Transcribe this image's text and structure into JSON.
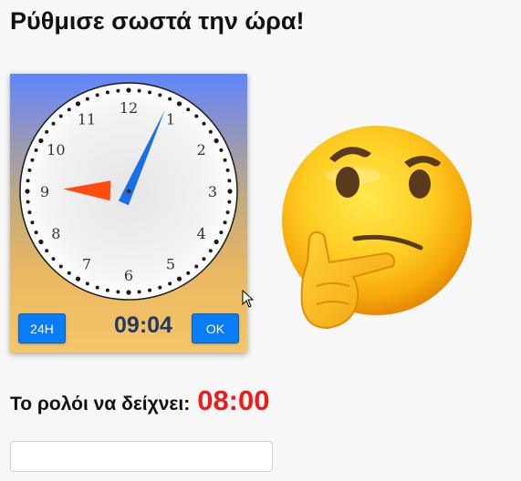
{
  "page": {
    "title": "Ρύθμισε σωστά την ώρα!"
  },
  "clock": {
    "numerals": [
      "12",
      "1",
      "2",
      "3",
      "4",
      "5",
      "6",
      "7",
      "8",
      "9",
      "10",
      "11"
    ],
    "hour_hand_value": 9,
    "minute_hand_value": 4,
    "hour_hand_color": "#ff4d10",
    "minute_hand_color": "#1a6ee8",
    "mode_button_label": "24H",
    "digital_time": "09:04",
    "ok_button_label": "OK"
  },
  "emoji": {
    "name": "thinking-face-icon"
  },
  "target": {
    "label": "Το ρολόι να δείχνει:",
    "time": "08:00",
    "time_color": "#ef1a1a"
  },
  "answer": {
    "value": "",
    "placeholder": ""
  }
}
